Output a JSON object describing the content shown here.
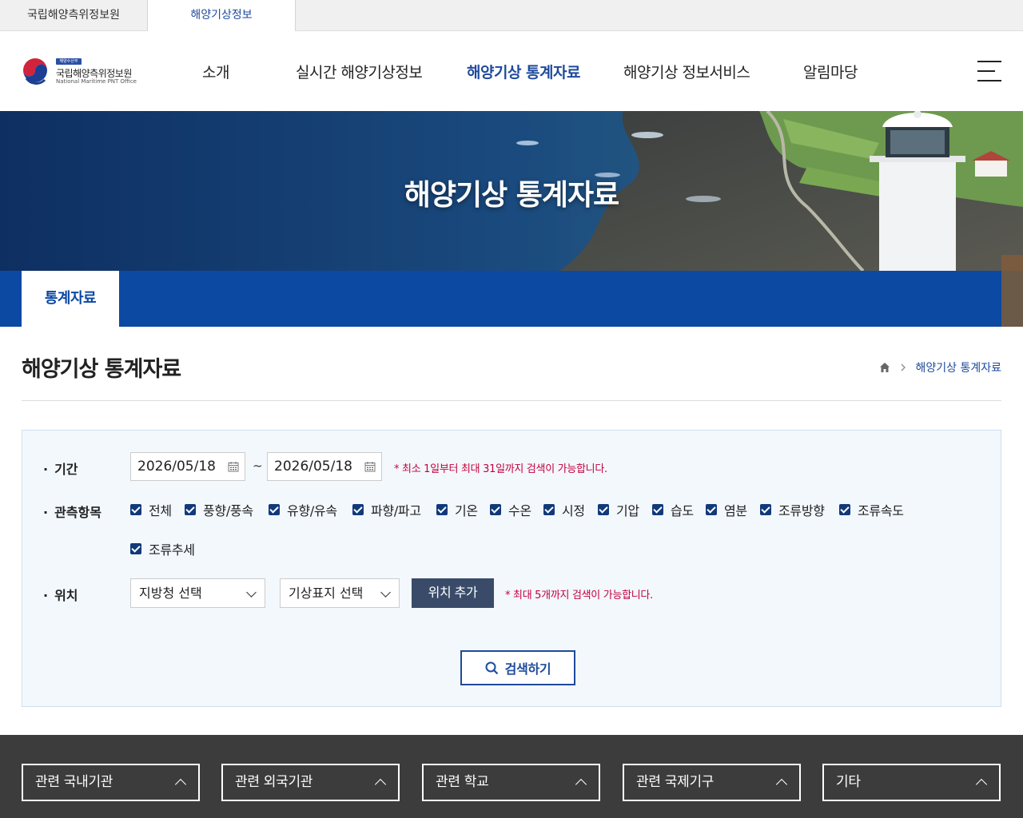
{
  "site_tabs": [
    "국립해양측위정보원",
    "해양기상정보"
  ],
  "logo": {
    "badge": "해양수산부",
    "name_ko": "국립해양측위정보원",
    "name_en": "National Maritime PNT Office"
  },
  "gnb": [
    "소개",
    "실시간 해양기상정보",
    "해양기상 통계자료",
    "해양기상 정보서비스",
    "알림마당"
  ],
  "gnb_active": "해양기상 통계자료",
  "hero_title": "해양기상 통계자료",
  "sub_tab": "통계자료",
  "page_title": "해양기상 통계자료",
  "breadcrumb": {
    "current": "해양기상 통계자료"
  },
  "search": {
    "period": {
      "label": "기간",
      "start": "2026/05/18",
      "separator": "~",
      "end": "2026/05/18",
      "notice": "* 최소 1일부터 최대 31일까지 검색이 가능합니다."
    },
    "items": {
      "label": "관측항목",
      "options": [
        {
          "label": "전체",
          "checked": true
        },
        {
          "label": "풍향/풍속",
          "checked": true
        },
        {
          "label": "유향/유속",
          "checked": true
        },
        {
          "label": "파향/파고",
          "checked": true
        },
        {
          "label": "기온",
          "checked": true
        },
        {
          "label": "수온",
          "checked": true
        },
        {
          "label": "시정",
          "checked": true
        },
        {
          "label": "기압",
          "checked": true
        },
        {
          "label": "습도",
          "checked": true
        },
        {
          "label": "염분",
          "checked": true
        },
        {
          "label": "조류방향",
          "checked": true
        },
        {
          "label": "조류속도",
          "checked": true
        },
        {
          "label": "조류추세",
          "checked": true
        }
      ]
    },
    "location": {
      "label": "위치",
      "office_select": "지방청 선택",
      "buoy_select": "기상표지 선택",
      "add_button": "위치 추가",
      "notice": "* 최대 5개까지 검색이 가능합니다."
    },
    "search_button": "검색하기"
  },
  "footer_selects": [
    "관련 국내기관",
    "관련 외국기관",
    "관련 학교",
    "관련 국제기구",
    "기타"
  ],
  "colors": {
    "primary": "#1e4a9c",
    "sub_bar": "#0c49a3",
    "notice": "#c4003b",
    "checkbox": "#123a7a",
    "footer": "#3c3c3c"
  }
}
